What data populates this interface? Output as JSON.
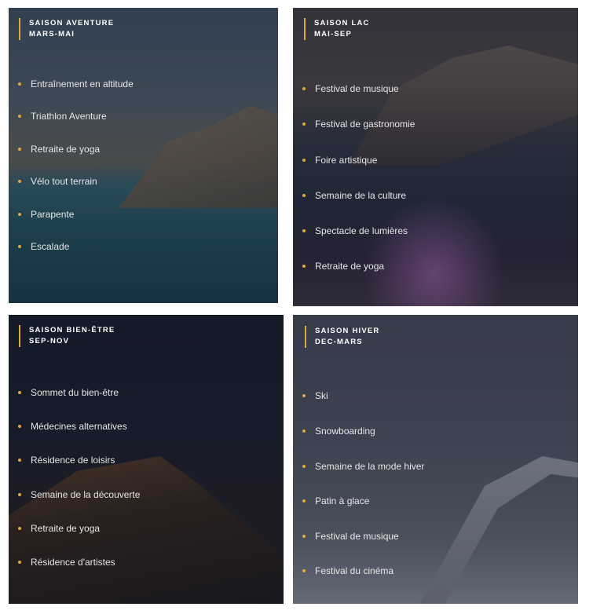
{
  "cards": [
    {
      "title": "SAISON AVENTURE",
      "period": "MARS-MAI",
      "items": [
        "Entraînement en altitude",
        "Triathlon Aventure",
        "Retraite de yoga",
        "Vélo tout terrain",
        "Parapente",
        "Escalade"
      ]
    },
    {
      "title": "SAISON LAC",
      "period": "MAI-SEP",
      "items": [
        "Festival de musique",
        "Festival de gastronomie",
        "Foire artistique",
        "Semaine de la culture",
        "Spectacle de lumières",
        "Retraite de yoga"
      ]
    },
    {
      "title": "SAISON BIEN-ÊTRE",
      "period": "SEP-NOV",
      "items": [
        "Sommet du bien-être",
        "Médecines alternatives",
        "Résidence de loisirs",
        "Semaine de la découverte",
        "Retraite de yoga",
        "Résidence d'artistes"
      ]
    },
    {
      "title": "SAISON HIVER",
      "period": "DEC-MARS",
      "items": [
        "Ski",
        "Snowboarding",
        "Semaine de la mode hiver",
        "Patin à glace",
        "Festival de musique",
        "Festival du cinéma"
      ]
    }
  ],
  "colors": {
    "accent": "#e3a83a",
    "text": "#e6e6e6"
  }
}
